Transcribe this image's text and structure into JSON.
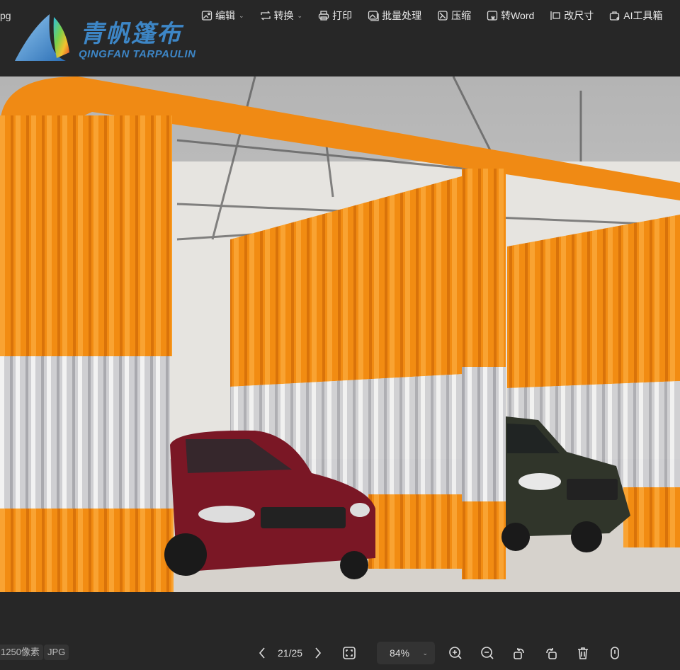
{
  "window": {
    "filename_fragment": "pg"
  },
  "logo": {
    "cn": "青帆篷布",
    "en": "QINGFAN TARPAULIN"
  },
  "toolbar": [
    {
      "label": "编辑",
      "icon": "image-edit-icon",
      "dropdown": true
    },
    {
      "label": "转换",
      "icon": "convert-icon",
      "dropdown": true
    },
    {
      "label": "打印",
      "icon": "print-icon"
    },
    {
      "label": "批量处理",
      "icon": "batch-icon"
    },
    {
      "label": "压缩",
      "icon": "compress-icon"
    },
    {
      "label": "转Word",
      "icon": "word-icon"
    },
    {
      "label": "改尺寸",
      "icon": "resize-icon"
    },
    {
      "label": "AI工具箱",
      "icon": "ai-toolbox-icon"
    }
  ],
  "status": {
    "pixels": "1250像素",
    "format": "JPG"
  },
  "nav": {
    "page": "21/25",
    "zoom": "84%"
  },
  "colors": {
    "bg": "#272727",
    "accent": "#3d86c6",
    "curtain": "#f08a14"
  }
}
